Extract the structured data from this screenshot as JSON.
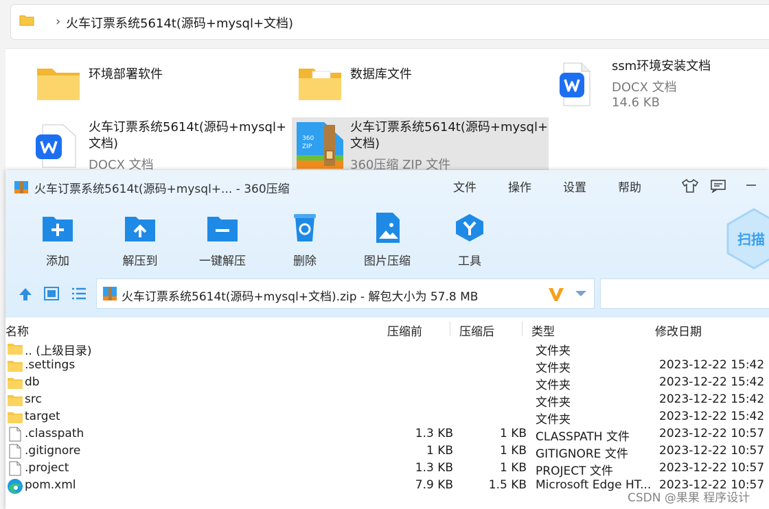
{
  "explorer": {
    "breadcrumb_sep": "›",
    "breadcrumb": "火车订票系统5614t(源码+mysql+文档)",
    "items": [
      {
        "name": "环境部署软件"
      },
      {
        "name": "数据库文件"
      },
      {
        "name": "ssm环境安装文档",
        "type": "DOCX 文档",
        "size": "14.6 KB"
      },
      {
        "name_line1": "火车订票系统5614t(源码+mysql+",
        "name_line2": "文档)",
        "type": "DOCX 文档"
      },
      {
        "name_line1": "火车订票系统5614t(源码+mysql+",
        "name_line2": "文档)",
        "type": "360压缩 ZIP 文件"
      }
    ]
  },
  "zip_window": {
    "title": "火车订票系统5614t(源码+mysql+... - 360压缩",
    "menu": [
      "文件",
      "操作",
      "设置",
      "帮助"
    ],
    "toolbar": [
      "添加",
      "解压到",
      "一键解压",
      "删除",
      "图片压缩",
      "工具"
    ],
    "scan_label": "扫描",
    "address": "火车订票系统5614t(源码+mysql+文档).zip - 解包大小为 57.8 MB",
    "columns": {
      "name": "名称",
      "before": "压缩前",
      "after": "压缩后",
      "type": "类型",
      "modified": "修改日期"
    },
    "rows": [
      {
        "name": ".. (上级目录)",
        "before": "",
        "after": "",
        "type": "文件夹",
        "modified": ""
      },
      {
        "name": ".settings",
        "before": "",
        "after": "",
        "type": "文件夹",
        "modified": "2023-12-22 15:42"
      },
      {
        "name": "db",
        "before": "",
        "after": "",
        "type": "文件夹",
        "modified": "2023-12-22 15:42"
      },
      {
        "name": "src",
        "before": "",
        "after": "",
        "type": "文件夹",
        "modified": "2023-12-22 15:42"
      },
      {
        "name": "target",
        "before": "",
        "after": "",
        "type": "文件夹",
        "modified": "2023-12-22 15:42"
      },
      {
        "name": ".classpath",
        "before": "1.3 KB",
        "after": "1 KB",
        "type": "CLASSPATH 文件",
        "modified": "2023-12-22 10:57"
      },
      {
        "name": ".gitignore",
        "before": "1 KB",
        "after": "1 KB",
        "type": "GITIGNORE 文件",
        "modified": "2023-12-22 10:57"
      },
      {
        "name": ".project",
        "before": "1.3 KB",
        "after": "1 KB",
        "type": "PROJECT 文件",
        "modified": "2023-12-22 10:57"
      },
      {
        "name": "pom.xml",
        "before": "7.9 KB",
        "after": "1.5 KB",
        "type": "Microsoft Edge HT...",
        "modified": "2023-12-22 10:57"
      }
    ]
  },
  "watermark": "CSDN @果果 程序设计",
  "colors": {
    "folder": "#f7c744",
    "wps": "#1d6ff2",
    "toolbar_blue": "#1e8ae6",
    "selection": "#e5e5e5"
  }
}
